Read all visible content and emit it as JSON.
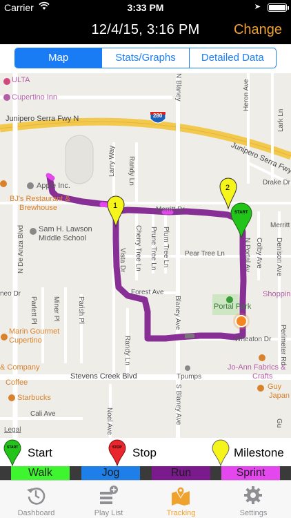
{
  "status_bar": {
    "carrier": "Carrier",
    "time": "3:33 PM"
  },
  "nav": {
    "title": "12/4/15, 3:16 PM",
    "change_label": "Change"
  },
  "segments": [
    {
      "label": "Map",
      "active": true
    },
    {
      "label": "Stats/Graphs",
      "active": false
    },
    {
      "label": "Detailed Data",
      "active": false
    }
  ],
  "map": {
    "labels": {
      "ulta": "ULTA",
      "cupertino_inn": "Cupertino Inn",
      "junipero_w": "Junipero Serra Fwy N",
      "junipero_e": "Junipero Serra Fwy",
      "highway_shield": "280",
      "n_blaney": "N Blaney",
      "heron_ave": "Heron Ave",
      "lark_ln": "Lark Ln",
      "larry_way": "Larry Way",
      "randy_ln_n": "Randy Ln",
      "drake_dr": "Drake Dr",
      "apple_inc": "Apple Inc.",
      "bjs_line1": "BJ's Restaurant &",
      "bjs_line2": "Brewhouse",
      "lawson_line1": "Sam H. Lawson",
      "lawson_line2": "Middle School",
      "merritt_w": "Merritt Dr",
      "merritt_e": "Merritt",
      "n_de_anza": "N De Anza Blvd",
      "cherry_tree": "Cherry Tree Ln",
      "prune_tree": "Prune Tree Ln",
      "plum_tree": "Plum Tree Ln",
      "pear_tree": "Pear Tree Ln",
      "vista_dr": "Vista Dr",
      "n_portal": "N Portal Av",
      "colby_ave": "Colby Ave",
      "denison_ave": "Denison Ave",
      "forest_ave": "Forest Ave",
      "meo_dr": "neo Dr",
      "blaney_ave": "Blaney Ave",
      "portal_park": "Portal Park",
      "shopping": "Shoppin",
      "parlett_pl": "Parlett Pl",
      "miner_pl": "Miner Pl",
      "parish_pl": "Parish Pl",
      "randy_ln_s": "Randy Ln",
      "wheaton_dr": "Wheaton Dr",
      "perimeter_rd": "Perimeter Rd",
      "marin_line1": "Marin Gourmet",
      "marin_line2": "Cupertino",
      "company": "& Company",
      "joann_line1": "Jo-Ann Fabrics &",
      "joann_line2": "Crafts",
      "stevens_creek": "Stevens Creek Blvd",
      "tpumps": "Tpumps",
      "coffee": "Coffee",
      "starbucks": "Starbucks",
      "s_blaney": "S Blaney Ave",
      "guy": "Guy",
      "japan": "Japan",
      "cali_ave": "Cali Ave",
      "noel_ave": "Noel Ave",
      "gu": "Gu",
      "legal": "Legal"
    },
    "markers": {
      "milestone_1": "1",
      "milestone_2": "2",
      "start": "START"
    }
  },
  "legend": [
    {
      "label": "Start",
      "color": "#22c41a",
      "icon": "start-pin-icon",
      "pin_text": "START"
    },
    {
      "label": "Stop",
      "color": "#e8262b",
      "icon": "stop-pin-icon",
      "pin_text": "STOP"
    },
    {
      "label": "Milestone",
      "color": "#f5f51c",
      "icon": "milestone-pin-icon",
      "pin_text": ""
    }
  ],
  "pace_legend": [
    {
      "label": "Walk",
      "color": "#3ef52f"
    },
    {
      "label": "Jog",
      "color": "#1f7fe8"
    },
    {
      "label": "Run",
      "color": "#7b1a8c"
    },
    {
      "label": "Sprint",
      "color": "#e447ee"
    }
  ],
  "tabs": [
    {
      "label": "Dashboard",
      "icon": "history-clock-icon",
      "active": false
    },
    {
      "label": "Play List",
      "icon": "playlist-add-icon",
      "active": false
    },
    {
      "label": "Tracking",
      "icon": "map-pin-icon",
      "active": true
    },
    {
      "label": "Settings",
      "icon": "gear-icon",
      "active": false
    }
  ],
  "colors": {
    "accent_orange": "#f0a22e",
    "segment_blue": "#1a7cf5",
    "route_purple": "#7b1a8c",
    "current_location": "#f5861f"
  }
}
